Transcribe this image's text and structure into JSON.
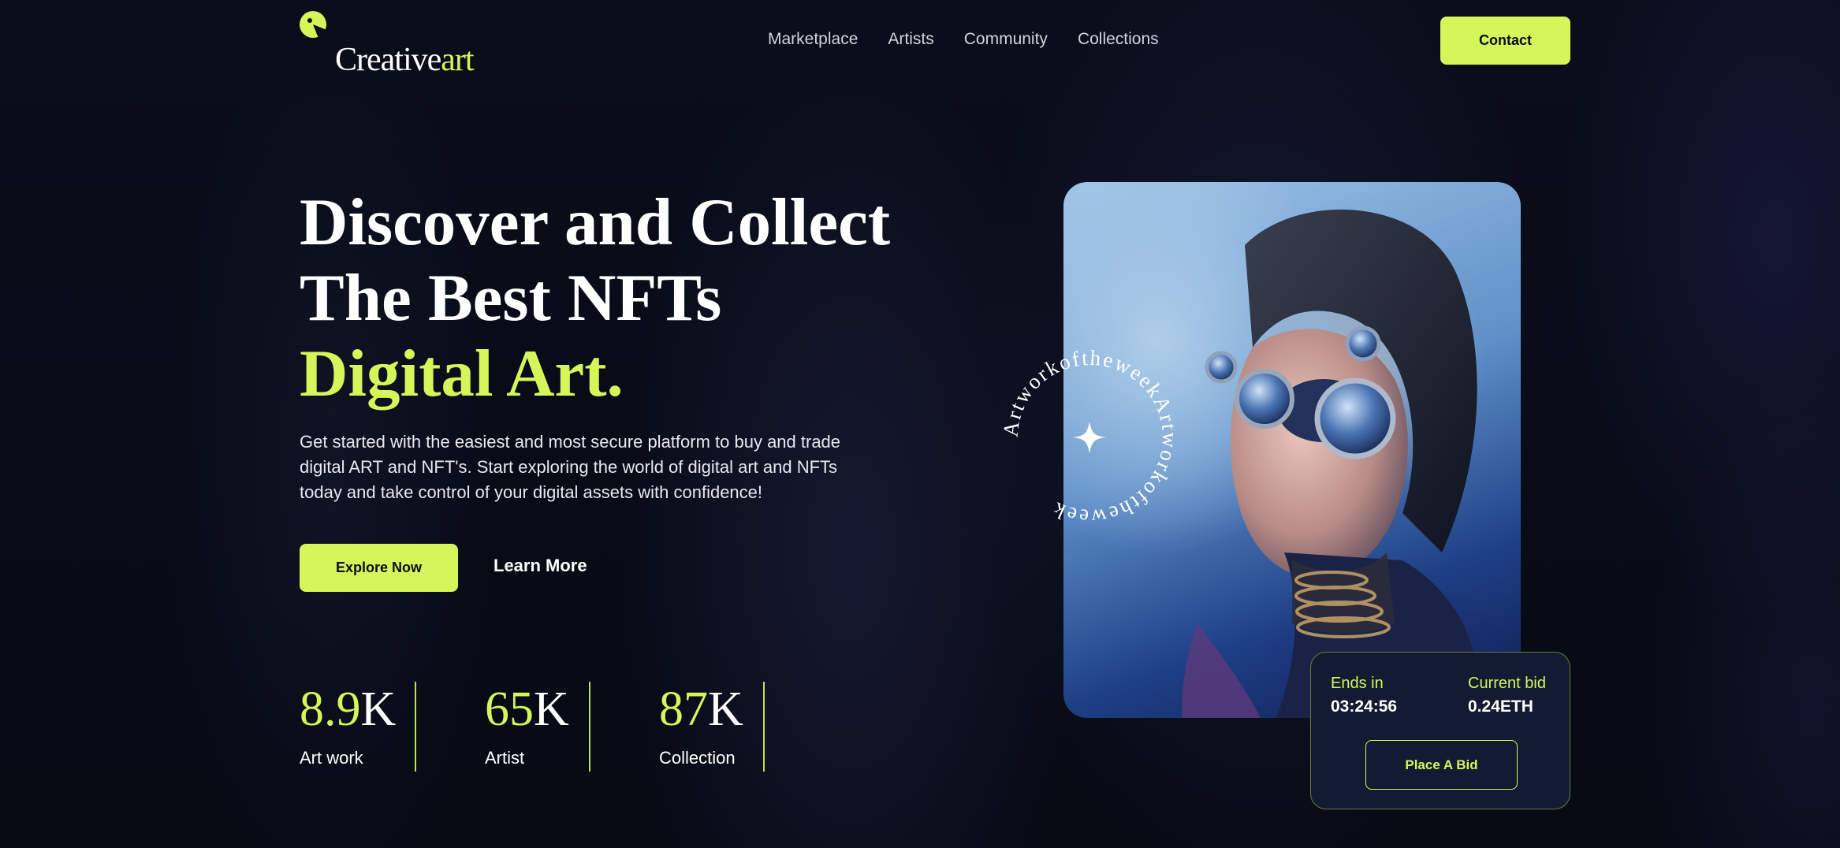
{
  "brand": {
    "name_main": "Creative",
    "name_accent": "art"
  },
  "nav": {
    "items": [
      "Marketplace",
      "Artists",
      "Community",
      "Collections"
    ]
  },
  "header": {
    "contact_label": "Contact"
  },
  "hero": {
    "title_line1": "Discover and Collect",
    "title_line2": "The Best NFTs",
    "title_line3": "Digital Art.",
    "description": "Get started with the easiest and most secure platform to buy and trade digital ART and NFT's. Start exploring the world of digital art and NFTs today and take control of your digital assets with confidence!",
    "explore_label": "Explore Now",
    "learn_label": "Learn More"
  },
  "stats": [
    {
      "value": "8.9",
      "unit": "K",
      "label": "Art work"
    },
    {
      "value": "65",
      "unit": "K",
      "label": "Artist"
    },
    {
      "value": "87",
      "unit": "K",
      "label": "Collection"
    }
  ],
  "artwork": {
    "badge_text": "ArtworkoftheweekArtworkoftheweek"
  },
  "bid": {
    "ends_label": "Ends in",
    "ends_value": "03:24:56",
    "current_label": "Current bid",
    "current_value": "0.24ETH",
    "button_label": "Place A Bid"
  },
  "colors": {
    "accent": "#d4f65b",
    "background": "#090b16",
    "card": "#131b33"
  }
}
